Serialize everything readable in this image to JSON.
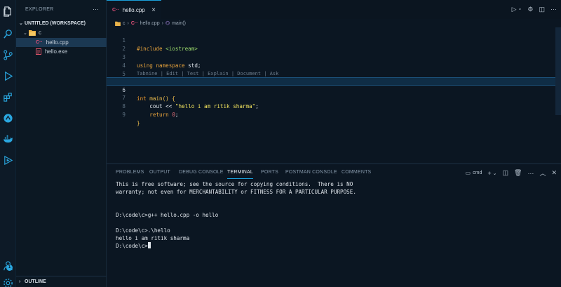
{
  "sidebar": {
    "title": "EXPLORER",
    "workspace": "UNTITLED (WORKSPACE)",
    "folder": "c",
    "files": [
      "hello.cpp",
      "hello.exe"
    ],
    "outline": "OUTLINE"
  },
  "tab": {
    "label": "hello.cpp",
    "close": "×"
  },
  "breadcrumb": {
    "folder": "c",
    "file": "hello.cpp",
    "symbol": "main()"
  },
  "editor": {
    "line_numbers": [
      "1",
      "2",
      "3",
      "4",
      "5",
      "6",
      "7",
      "8",
      "9"
    ],
    "codelens": "Tabnine | Edit | Test | Explain | Document | Ask",
    "line1": {
      "directive": "#include",
      "header": "<iostream>"
    },
    "line3": {
      "using": "using",
      "namespace": "namespace",
      "std": "std;"
    },
    "line6": {
      "type": "int",
      "name": "main",
      "rest": "() {"
    },
    "line7": {
      "cout": "cout",
      "op": "<<",
      "str": "\"hello i am ritik sharma\"",
      "semi": ";"
    },
    "line8": {
      "ret": "return",
      "num": "0",
      "semi": ";"
    },
    "line9": {
      "brace": "}"
    }
  },
  "panel": {
    "tabs": [
      "PROBLEMS",
      "OUTPUT",
      "DEBUG CONSOLE",
      "TERMINAL",
      "PORTS",
      "POSTMAN CONSOLE",
      "COMMENTS"
    ],
    "active_tab": "TERMINAL",
    "shell": "cmd",
    "terminal": [
      "This is free software; see the source for copying conditions.  There is NO",
      "warranty; not even for MERCHANTABILITY or FITNESS FOR A PARTICULAR PURPOSE.",
      "",
      "",
      "D:\\code\\c>g++ hello.cpp -o hello",
      "",
      "D:\\code\\c>.\\hello",
      "hello i am ritik sharma",
      "D:\\code\\c>"
    ]
  },
  "activity": {
    "badge": "1"
  }
}
